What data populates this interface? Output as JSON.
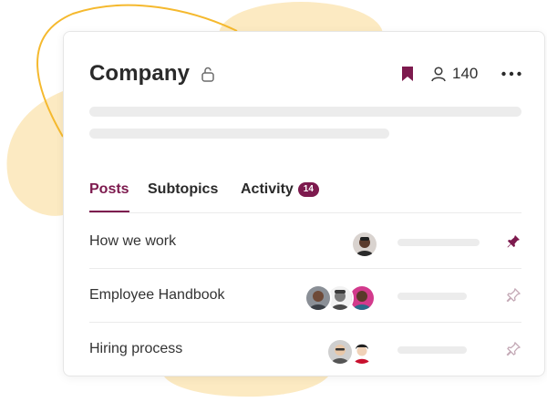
{
  "group": {
    "title": "Company",
    "member_count": "140",
    "bookmarked": true
  },
  "tabs": [
    {
      "label": "Posts",
      "active": true
    },
    {
      "label": "Subtopics",
      "active": false
    },
    {
      "label": "Activity",
      "active": false,
      "badge": "14"
    }
  ],
  "posts": [
    {
      "title": "How we work",
      "avatars": [
        "avatar-1"
      ],
      "pinned": true
    },
    {
      "title": "Employee Handbook",
      "avatars": [
        "avatar-2",
        "avatar-3",
        "avatar-4"
      ],
      "pinned": false
    },
    {
      "title": "Hiring process",
      "avatars": [
        "avatar-5",
        "avatar-6"
      ],
      "pinned": false
    }
  ],
  "icons": {
    "lock": "lock-icon",
    "bookmark": "bookmark-icon",
    "members": "person-icon",
    "more": "more-horizontal-icon",
    "pin": "pin-icon"
  },
  "colors": {
    "accent": "#7d1a4e",
    "decoration_yellow": "#fbe3ae",
    "decoration_outline": "#f5b92e",
    "skeleton": "#ececec",
    "pin_inactive": "#c4a9b6"
  }
}
